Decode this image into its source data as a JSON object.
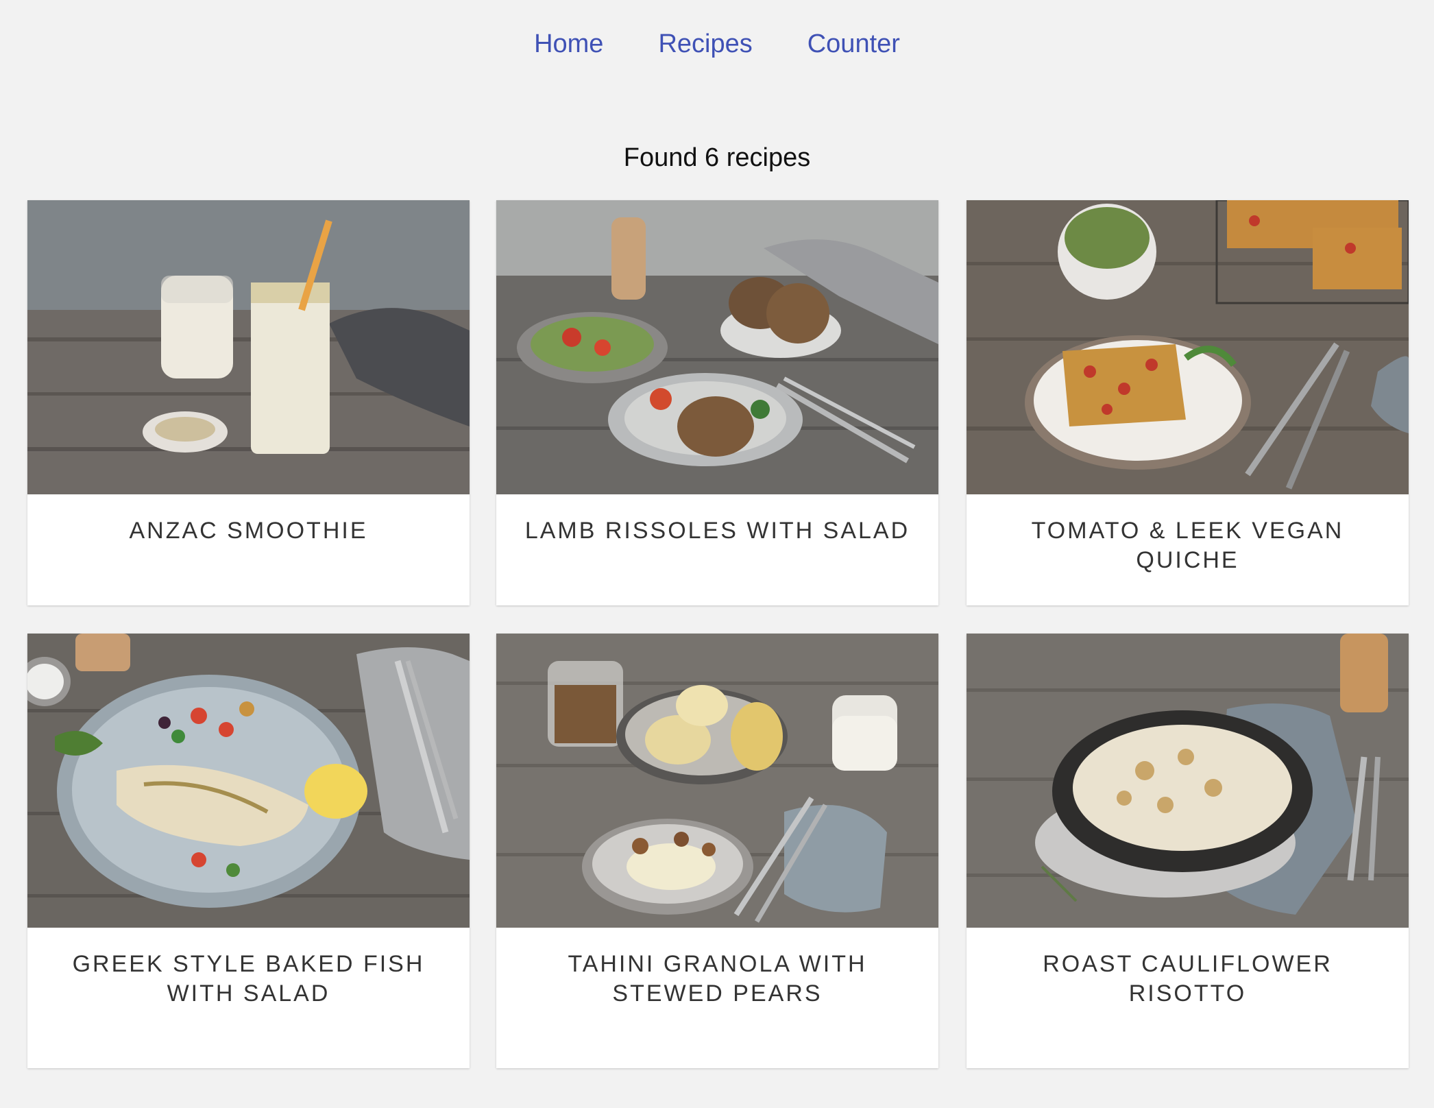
{
  "nav": {
    "home": "Home",
    "recipes": "Recipes",
    "counter": "Counter"
  },
  "results": {
    "summary": "Found 6 recipes"
  },
  "recipes": [
    {
      "title": "ANZAC SMOOTHIE"
    },
    {
      "title": "LAMB RISSOLES WITH SALAD"
    },
    {
      "title": "TOMATO & LEEK VEGAN QUICHE"
    },
    {
      "title": "GREEK STYLE BAKED FISH WITH SALAD"
    },
    {
      "title": "TAHINI GRANOLA WITH STEWED PEARS"
    },
    {
      "title": "ROAST CAULIFLOWER RISOTTO"
    }
  ],
  "colors": {
    "link": "#3f51b5",
    "background": "#f2f2f2",
    "card": "#ffffff"
  }
}
